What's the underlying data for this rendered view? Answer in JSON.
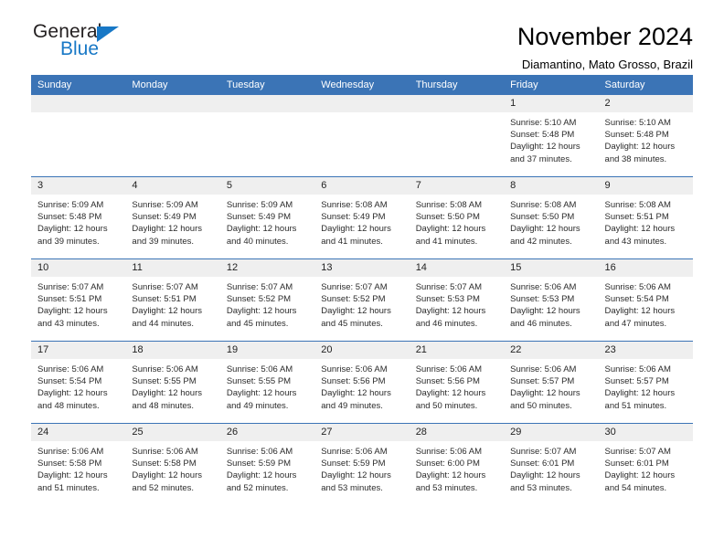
{
  "brand": {
    "name_part1": "General",
    "name_part2": "Blue",
    "triangle_color": "#1878c6"
  },
  "header": {
    "title": "November 2024",
    "subtitle": "Diamantino, Mato Grosso, Brazil"
  },
  "theme": {
    "header_row_bg": "#3b74b6",
    "daynum_band_bg": "#efefef",
    "text_color": "#000000"
  },
  "weekday_headers": [
    "Sunday",
    "Monday",
    "Tuesday",
    "Wednesday",
    "Thursday",
    "Friday",
    "Saturday"
  ],
  "weeks": [
    [
      {
        "day": "",
        "sunrise": "",
        "sunset": "",
        "daylight_line1": "",
        "daylight_line2": ""
      },
      {
        "day": "",
        "sunrise": "",
        "sunset": "",
        "daylight_line1": "",
        "daylight_line2": ""
      },
      {
        "day": "",
        "sunrise": "",
        "sunset": "",
        "daylight_line1": "",
        "daylight_line2": ""
      },
      {
        "day": "",
        "sunrise": "",
        "sunset": "",
        "daylight_line1": "",
        "daylight_line2": ""
      },
      {
        "day": "",
        "sunrise": "",
        "sunset": "",
        "daylight_line1": "",
        "daylight_line2": ""
      },
      {
        "day": "1",
        "sunrise": "Sunrise: 5:10 AM",
        "sunset": "Sunset: 5:48 PM",
        "daylight_line1": "Daylight: 12 hours",
        "daylight_line2": "and 37 minutes."
      },
      {
        "day": "2",
        "sunrise": "Sunrise: 5:10 AM",
        "sunset": "Sunset: 5:48 PM",
        "daylight_line1": "Daylight: 12 hours",
        "daylight_line2": "and 38 minutes."
      }
    ],
    [
      {
        "day": "3",
        "sunrise": "Sunrise: 5:09 AM",
        "sunset": "Sunset: 5:48 PM",
        "daylight_line1": "Daylight: 12 hours",
        "daylight_line2": "and 39 minutes."
      },
      {
        "day": "4",
        "sunrise": "Sunrise: 5:09 AM",
        "sunset": "Sunset: 5:49 PM",
        "daylight_line1": "Daylight: 12 hours",
        "daylight_line2": "and 39 minutes."
      },
      {
        "day": "5",
        "sunrise": "Sunrise: 5:09 AM",
        "sunset": "Sunset: 5:49 PM",
        "daylight_line1": "Daylight: 12 hours",
        "daylight_line2": "and 40 minutes."
      },
      {
        "day": "6",
        "sunrise": "Sunrise: 5:08 AM",
        "sunset": "Sunset: 5:49 PM",
        "daylight_line1": "Daylight: 12 hours",
        "daylight_line2": "and 41 minutes."
      },
      {
        "day": "7",
        "sunrise": "Sunrise: 5:08 AM",
        "sunset": "Sunset: 5:50 PM",
        "daylight_line1": "Daylight: 12 hours",
        "daylight_line2": "and 41 minutes."
      },
      {
        "day": "8",
        "sunrise": "Sunrise: 5:08 AM",
        "sunset": "Sunset: 5:50 PM",
        "daylight_line1": "Daylight: 12 hours",
        "daylight_line2": "and 42 minutes."
      },
      {
        "day": "9",
        "sunrise": "Sunrise: 5:08 AM",
        "sunset": "Sunset: 5:51 PM",
        "daylight_line1": "Daylight: 12 hours",
        "daylight_line2": "and 43 minutes."
      }
    ],
    [
      {
        "day": "10",
        "sunrise": "Sunrise: 5:07 AM",
        "sunset": "Sunset: 5:51 PM",
        "daylight_line1": "Daylight: 12 hours",
        "daylight_line2": "and 43 minutes."
      },
      {
        "day": "11",
        "sunrise": "Sunrise: 5:07 AM",
        "sunset": "Sunset: 5:51 PM",
        "daylight_line1": "Daylight: 12 hours",
        "daylight_line2": "and 44 minutes."
      },
      {
        "day": "12",
        "sunrise": "Sunrise: 5:07 AM",
        "sunset": "Sunset: 5:52 PM",
        "daylight_line1": "Daylight: 12 hours",
        "daylight_line2": "and 45 minutes."
      },
      {
        "day": "13",
        "sunrise": "Sunrise: 5:07 AM",
        "sunset": "Sunset: 5:52 PM",
        "daylight_line1": "Daylight: 12 hours",
        "daylight_line2": "and 45 minutes."
      },
      {
        "day": "14",
        "sunrise": "Sunrise: 5:07 AM",
        "sunset": "Sunset: 5:53 PM",
        "daylight_line1": "Daylight: 12 hours",
        "daylight_line2": "and 46 minutes."
      },
      {
        "day": "15",
        "sunrise": "Sunrise: 5:06 AM",
        "sunset": "Sunset: 5:53 PM",
        "daylight_line1": "Daylight: 12 hours",
        "daylight_line2": "and 46 minutes."
      },
      {
        "day": "16",
        "sunrise": "Sunrise: 5:06 AM",
        "sunset": "Sunset: 5:54 PM",
        "daylight_line1": "Daylight: 12 hours",
        "daylight_line2": "and 47 minutes."
      }
    ],
    [
      {
        "day": "17",
        "sunrise": "Sunrise: 5:06 AM",
        "sunset": "Sunset: 5:54 PM",
        "daylight_line1": "Daylight: 12 hours",
        "daylight_line2": "and 48 minutes."
      },
      {
        "day": "18",
        "sunrise": "Sunrise: 5:06 AM",
        "sunset": "Sunset: 5:55 PM",
        "daylight_line1": "Daylight: 12 hours",
        "daylight_line2": "and 48 minutes."
      },
      {
        "day": "19",
        "sunrise": "Sunrise: 5:06 AM",
        "sunset": "Sunset: 5:55 PM",
        "daylight_line1": "Daylight: 12 hours",
        "daylight_line2": "and 49 minutes."
      },
      {
        "day": "20",
        "sunrise": "Sunrise: 5:06 AM",
        "sunset": "Sunset: 5:56 PM",
        "daylight_line1": "Daylight: 12 hours",
        "daylight_line2": "and 49 minutes."
      },
      {
        "day": "21",
        "sunrise": "Sunrise: 5:06 AM",
        "sunset": "Sunset: 5:56 PM",
        "daylight_line1": "Daylight: 12 hours",
        "daylight_line2": "and 50 minutes."
      },
      {
        "day": "22",
        "sunrise": "Sunrise: 5:06 AM",
        "sunset": "Sunset: 5:57 PM",
        "daylight_line1": "Daylight: 12 hours",
        "daylight_line2": "and 50 minutes."
      },
      {
        "day": "23",
        "sunrise": "Sunrise: 5:06 AM",
        "sunset": "Sunset: 5:57 PM",
        "daylight_line1": "Daylight: 12 hours",
        "daylight_line2": "and 51 minutes."
      }
    ],
    [
      {
        "day": "24",
        "sunrise": "Sunrise: 5:06 AM",
        "sunset": "Sunset: 5:58 PM",
        "daylight_line1": "Daylight: 12 hours",
        "daylight_line2": "and 51 minutes."
      },
      {
        "day": "25",
        "sunrise": "Sunrise: 5:06 AM",
        "sunset": "Sunset: 5:58 PM",
        "daylight_line1": "Daylight: 12 hours",
        "daylight_line2": "and 52 minutes."
      },
      {
        "day": "26",
        "sunrise": "Sunrise: 5:06 AM",
        "sunset": "Sunset: 5:59 PM",
        "daylight_line1": "Daylight: 12 hours",
        "daylight_line2": "and 52 minutes."
      },
      {
        "day": "27",
        "sunrise": "Sunrise: 5:06 AM",
        "sunset": "Sunset: 5:59 PM",
        "daylight_line1": "Daylight: 12 hours",
        "daylight_line2": "and 53 minutes."
      },
      {
        "day": "28",
        "sunrise": "Sunrise: 5:06 AM",
        "sunset": "Sunset: 6:00 PM",
        "daylight_line1": "Daylight: 12 hours",
        "daylight_line2": "and 53 minutes."
      },
      {
        "day": "29",
        "sunrise": "Sunrise: 5:07 AM",
        "sunset": "Sunset: 6:01 PM",
        "daylight_line1": "Daylight: 12 hours",
        "daylight_line2": "and 53 minutes."
      },
      {
        "day": "30",
        "sunrise": "Sunrise: 5:07 AM",
        "sunset": "Sunset: 6:01 PM",
        "daylight_line1": "Daylight: 12 hours",
        "daylight_line2": "and 54 minutes."
      }
    ]
  ]
}
